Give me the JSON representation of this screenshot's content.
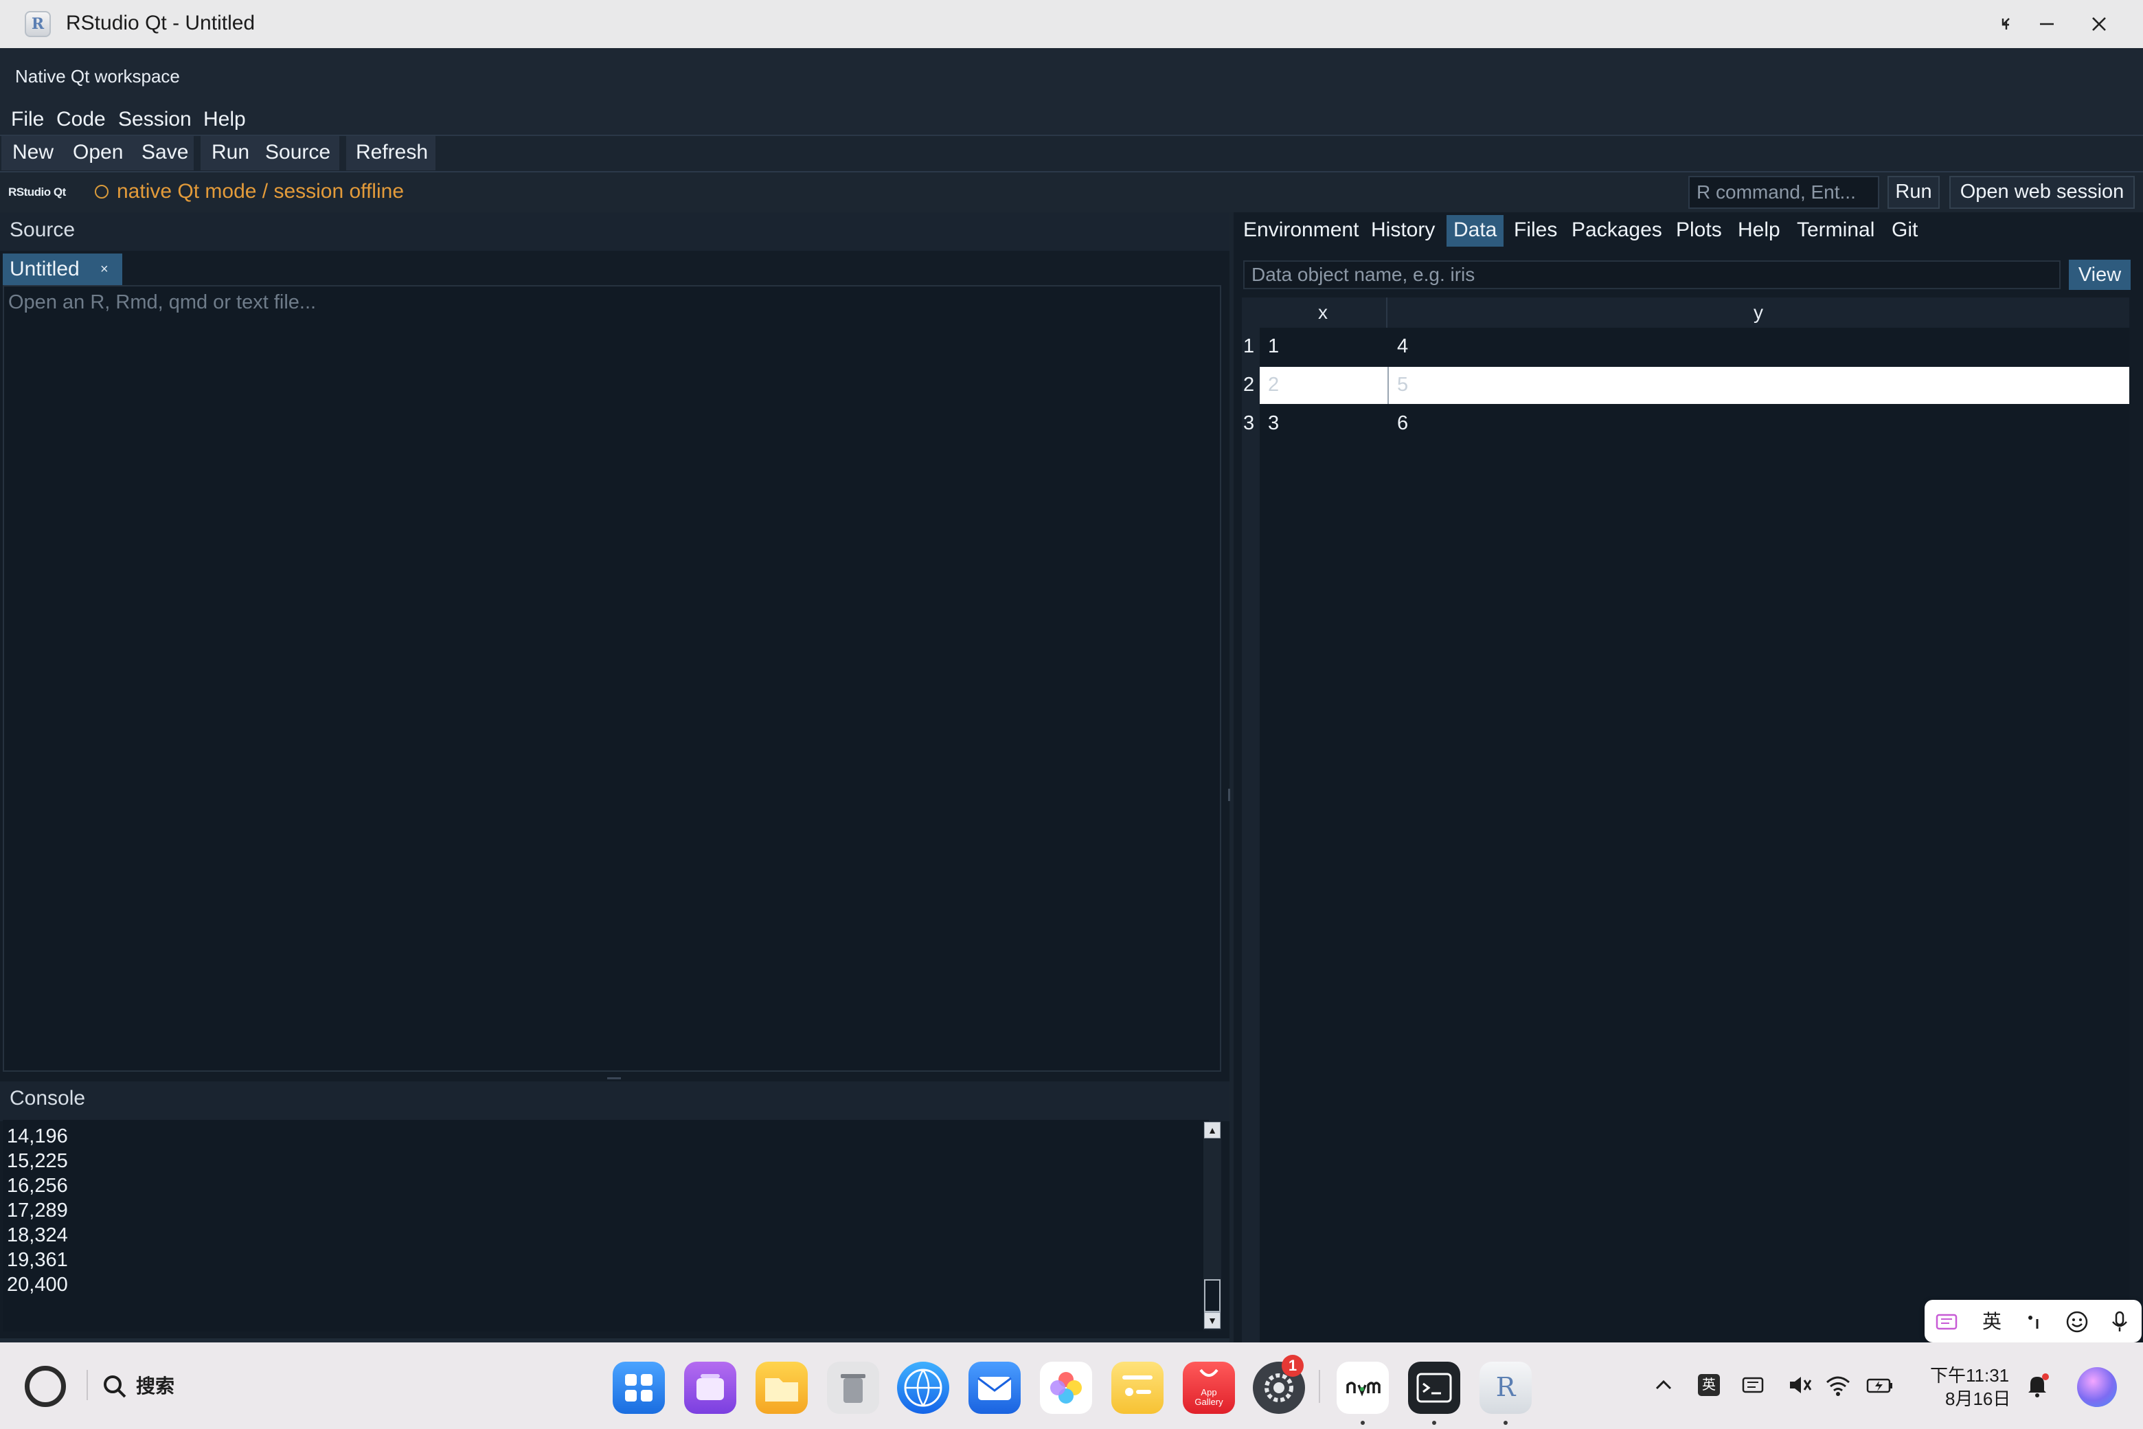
{
  "window": {
    "title": "RStudio Qt - Untitled",
    "icon_letter": "R"
  },
  "workspace": {
    "title": "Native Qt workspace"
  },
  "menu": [
    "File",
    "Code",
    "Session",
    "Help"
  ],
  "toolbar": {
    "new_label": "New",
    "open_label": "Open",
    "save_label": "Save",
    "run_label": "Run",
    "source_label": "Source",
    "refresh_label": "Refresh"
  },
  "status": {
    "brand": "RStudio Qt",
    "mode_text": "native Qt mode / session offline",
    "command_placeholder": "R command, Ent...",
    "run_label": "Run",
    "open_web_label": "Open web session",
    "status_color": "#e39b3a"
  },
  "source": {
    "title": "Source",
    "tab_label": "Untitled",
    "tab_close": "×",
    "placeholder": "Open an R, Rmd, qmd or text file..."
  },
  "console": {
    "title": "Console",
    "lines": [
      "14,196",
      "15,225",
      "16,256",
      "17,289",
      "18,324",
      "19,361",
      "20,400"
    ]
  },
  "right_tabs": {
    "items": [
      "Environment",
      "History",
      "Data",
      "Files",
      "Packages",
      "Plots",
      "Help",
      "Terminal",
      "Git"
    ],
    "active": "Data"
  },
  "data_viewer": {
    "input_placeholder": "Data object name, e.g. iris",
    "view_label": "View",
    "columns": [
      "x",
      "y"
    ],
    "rows": [
      {
        "num": "1",
        "x": "1",
        "y": "4"
      },
      {
        "num": "2",
        "x": "2",
        "y": "5"
      },
      {
        "num": "3",
        "x": "3",
        "y": "6"
      }
    ],
    "selected_row": "2"
  },
  "ime": {
    "language_label": "英"
  },
  "taskbar": {
    "search_label": "搜索",
    "appgallery_label_1": "App",
    "appgallery_label_2": "Gallery",
    "settings_badge": "1",
    "tray_lang": "英",
    "clock_time": "下午11:31",
    "clock_date": "8月16日",
    "icons": [
      "start-icon",
      "search-icon",
      "launcher-icon",
      "multitask-icon",
      "file-manager-icon",
      "trash-icon",
      "browser-icon",
      "mail-icon",
      "photos-icon",
      "notes-icon",
      "app-gallery-icon",
      "settings-icon",
      "nvm-app-icon",
      "terminal-icon",
      "rstudio-icon"
    ]
  },
  "colors": {
    "accent": "#2e5b7e",
    "background": "#131c26",
    "status_orange": "#e39b3a"
  }
}
